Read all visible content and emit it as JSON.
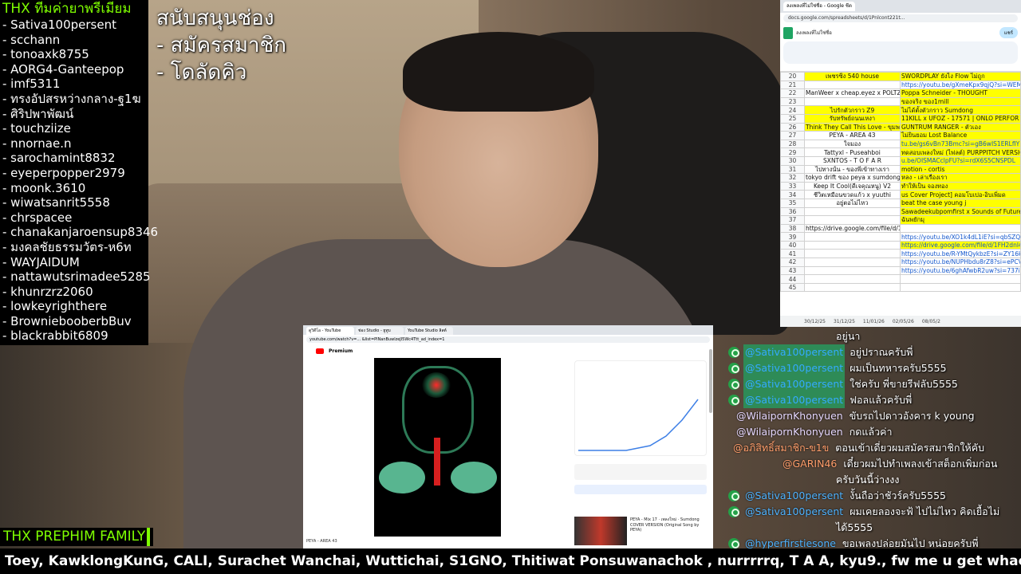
{
  "donors": {
    "header": "THX ทีมค่ายาพรีเมียม",
    "names": [
      "- Sativa100persent",
      "- scchann",
      "- tonoaxk8755",
      "- AORG4-Ganteepop",
      "- imf5311",
      "- ทรงอัปสรหว่างกลาง-ฐ1ฆ",
      "- ศิริปพาพัฒน์",
      "- touchziize",
      "- nnornae.n",
      "- sarochamint8832",
      "- eyeperpopper2979",
      "- moonk.3610",
      "- wiwatsanrit5558",
      "- chrspacee",
      "- chanakanjaroensup8346",
      "- มงคลชัยธรรมวัตร-ห6ท",
      "- WAYJAIDUM",
      "- nattawutsrimadee5285",
      "- khunrzrz2060",
      "- lowkeyrighthere",
      "- BrowniebooberbBuv",
      "- blackrabbit6809"
    ]
  },
  "promo": {
    "line1": "สนับสนุนช่อง",
    "line2": "- สมัครสมาชิก",
    "line3": "- โดลัดคิว"
  },
  "sheet": {
    "tab_label": "ลงเพลงที่ไม่ใช่ชื่อ - Google ชีต",
    "url": "docs.google.com/spreadsheets/d/1Pnlcont221t...",
    "doc_title": "ลงเพลงที่ไม่ใช่ชื่อ",
    "share_label": "แชร์",
    "rows": [
      {
        "n": "20",
        "a": "เพชรซิ่ง 540 house",
        "b": "SWORDPLAY ยังไง Flow ไม่ถูก"
      },
      {
        "n": "21",
        "a": "",
        "b": "https://youtu.be/gXmeKpx9qjQ?si=WEMrNWWC0Up"
      },
      {
        "n": "22",
        "a": "ManWeer x cheap.eyez x POLTZX - ปีกเสียหายแล้ว",
        "b": "Poppa Schneider - THOUGHT"
      },
      {
        "n": "23",
        "a": "",
        "b": "ของจริง ของ1mill"
      },
      {
        "n": "24",
        "a": "ไปรักตัวกราว Z9",
        "b": "ไม่ได้ตั้งตัวกราว Sumdong"
      },
      {
        "n": "25",
        "a": "รับทรัพย์ถนนเหงา",
        "b": "11KILL x UFOZ - 17571 | ONLO PERFOR"
      },
      {
        "n": "26",
        "a": "Think They Call This Love - ขุมพล",
        "b": "GUNTRUM RANGER - ตัวเอง"
      },
      {
        "n": "27",
        "a": "PEYA - AREA 43",
        "b": "ไม่ยินยอม Lost Balance"
      },
      {
        "n": "28",
        "a": "ใจมอง",
        "b": "tu.be/gs6vBn73Bmc?si=gB6wIS1ERLfIY"
      },
      {
        "n": "29",
        "a": "Tattyxl - Puseahboi",
        "b": "ทดสอบเพลงใหม่ (ไฟลต์) PURPPITCH VERSION"
      },
      {
        "n": "30",
        "a": "SXNTOS - T O F A R",
        "b": "u.be/OISMACclpFU?si=rdX6S5CNSPDL"
      },
      {
        "n": "31",
        "a": "ไปทางนั้น - ของพี่เข้าทางเรา",
        "b": "motion - cortis"
      },
      {
        "n": "32",
        "a": "tokyo drift ของ peya x sumdong",
        "b": "หลง - เล่าเรื่องเรา"
      },
      {
        "n": "33",
        "a": "Keep It Cool(ดีเจคุณหนู) V2",
        "b": "ทำให้เป็น จองทอง"
      },
      {
        "n": "34",
        "a": "ชีวิตเหมือนขวดแก้ว x yuuthi",
        "b": "us Cover Project] คอมโบเปอ-อิบเพิ่มด"
      },
      {
        "n": "35",
        "a": "อยู่ตอไม่ไหว",
        "b": "beat the case young j"
      },
      {
        "n": "36",
        "a": "",
        "b": "Sawadeekubpomfirst x Sounds of Future"
      },
      {
        "n": "37",
        "a": "",
        "b": "ฉันพยักมุ"
      },
      {
        "n": "38",
        "a": "https://drive.google.com/file/d/1MGwwRfNlCIpZ3EfWwEg4JILcnL8Rg",
        "b": ""
      },
      {
        "n": "39",
        "a": "",
        "b": "https://youtu.be/XO1k4dL1iE?si=qbSZQ7goamFAU"
      },
      {
        "n": "40",
        "a": "",
        "b": "https://drive.google.com/file/d/1FH2dnl4LKXR9snoAAdRjp8"
      },
      {
        "n": "41",
        "a": "",
        "b": "https://youtu.be/R-YMtQykbzE?si=ZY16kD8xHMGL"
      },
      {
        "n": "42",
        "a": "",
        "b": "https://youtu.be/NUPHbdu8rZ8?si=ePCVmyLsIVe1"
      },
      {
        "n": "43",
        "a": "",
        "b": "https://youtu.be/6ghAfwbR2uw?si=737iWDVXk-FI4"
      },
      {
        "n": "44",
        "a": "",
        "b": ""
      },
      {
        "n": "45",
        "a": "",
        "b": ""
      }
    ],
    "bottom_tabs": [
      "30/12/25",
      "31/12/25",
      "11/01/26",
      "02/05/26",
      "08/05/2"
    ]
  },
  "yt": {
    "tabs": [
      "ดูวิดีโอ - YouTube",
      "ช่อง Studio - ยูทูบ",
      "YouTube Studio ลิสต์"
    ],
    "url": "youtube.com/watch?v=... &list=PlNanBuwlzeJl5Wc4Ttt_ad_index=1",
    "brand": "Premium",
    "caption": "PEYA - AREA 43",
    "thumb_text": "PEYA - Mix 17 · เพลงใหม่ · Sumdong COVER VERSION (Original Song by PEYA)"
  },
  "chat": [
    {
      "user": "",
      "text": "อยู่นา",
      "style": "none"
    },
    {
      "user": "@Sativa100persent",
      "text": "อยู่ปราณครับพี่",
      "style": "green"
    },
    {
      "user": "@Sativa100persent",
      "text": "ผมเป็นทหารครับ5555",
      "style": "green"
    },
    {
      "user": "@Sativa100persent",
      "text": "ใช่ครับ พี่ขายรีฟลับ5555",
      "style": "green"
    },
    {
      "user": "@Sativa100persent",
      "text": "ฟอลแล้วครับพี่",
      "style": "green"
    },
    {
      "user": "@WilaipornKhonyuen",
      "text": "ขับรถไปดาวอังคาร k young",
      "style": "purple"
    },
    {
      "user": "@WilaipornKhonyuen",
      "text": "กดแล้วค่า",
      "style": "purple"
    },
    {
      "user": "@อภิสิทธิ์สมาชิก-ข1ข",
      "text": "ตอนเข้าเดี่ยวผมสมัครสมาชิกให้คับ",
      "style": "orange"
    },
    {
      "user": "@GARIN46",
      "text": "เดี๋ยวผมไปทำเพลงเข้าสต็อกเพิ่มก่อน",
      "cont": "ครับวันนี้ว่างงง",
      "style": "orange2"
    },
    {
      "user": "@Sativa100persent",
      "text": "งั้นถือว่าชัวร์ครับ5555",
      "style": "blue"
    },
    {
      "user": "@Sativa100persent",
      "text": "ผมเคยลองจะฟ้ ไปไม่ไหว คิดเยื้อไม่",
      "cont": "ได้5555",
      "style": "blue"
    },
    {
      "user": "@hyperfirstiesone",
      "text": "ขอเพลงปล่อยมันไป หน่อยครับพี่",
      "style": "blue"
    }
  ],
  "family": "THX PREPHIM FAMILY",
  "ticker": "Toey, KawklongKunG, CALI, Surachet Wanchai, Wuttichai, S1GNO, Thitiwat Ponsuwanachok , nurrrrrq, T A A, kyu9., fw me u get whack!, Hot"
}
